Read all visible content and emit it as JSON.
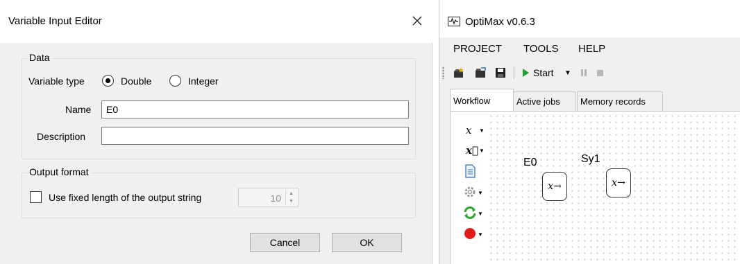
{
  "dialog": {
    "title": "Variable Input Editor",
    "data_group": {
      "label": "Data",
      "variable_type_label": "Variable type",
      "radio_double": "Double",
      "radio_integer": "Integer",
      "selected": "Double",
      "name_label": "Name",
      "name_value": "E0",
      "description_label": "Description",
      "description_value": ""
    },
    "output_group": {
      "label": "Output format",
      "checkbox_label": "Use fixed length of the output string",
      "checkbox_checked": false,
      "length_value": "10"
    },
    "cancel_label": "Cancel",
    "ok_label": "OK"
  },
  "app": {
    "title": "OptiMax v0.6.3",
    "menu": [
      "PROJECT",
      "TOOLS",
      "HELP"
    ],
    "toolbar": {
      "start_label": "Start",
      "icons": [
        "new-project-icon",
        "open-project-icon",
        "save-icon",
        "start-icon",
        "pause-icon",
        "stop-icon"
      ]
    },
    "tabs": [
      "Workflow",
      "Active jobs",
      "Memory records"
    ],
    "active_tab": "Workflow",
    "palette": [
      {
        "glyph": "x",
        "icon": "scalar-variable-icon"
      },
      {
        "glyph": "x⃗",
        "icon": "vector-variable-icon"
      },
      {
        "glyph": "",
        "icon": "document-icon"
      },
      {
        "glyph": "",
        "icon": "settings-icon"
      },
      {
        "glyph": "",
        "icon": "loop-icon"
      },
      {
        "glyph": "",
        "icon": "record-icon"
      }
    ],
    "nodes": [
      {
        "label": "E0",
        "symbol": "x→"
      },
      {
        "label": "Sy1",
        "symbol": "x→"
      }
    ]
  },
  "colors": {
    "start_green": "#1e9e2e",
    "record_red": "#e31b1b",
    "loop_green": "#2fa52f",
    "document_blue": "#2a6fbf"
  }
}
